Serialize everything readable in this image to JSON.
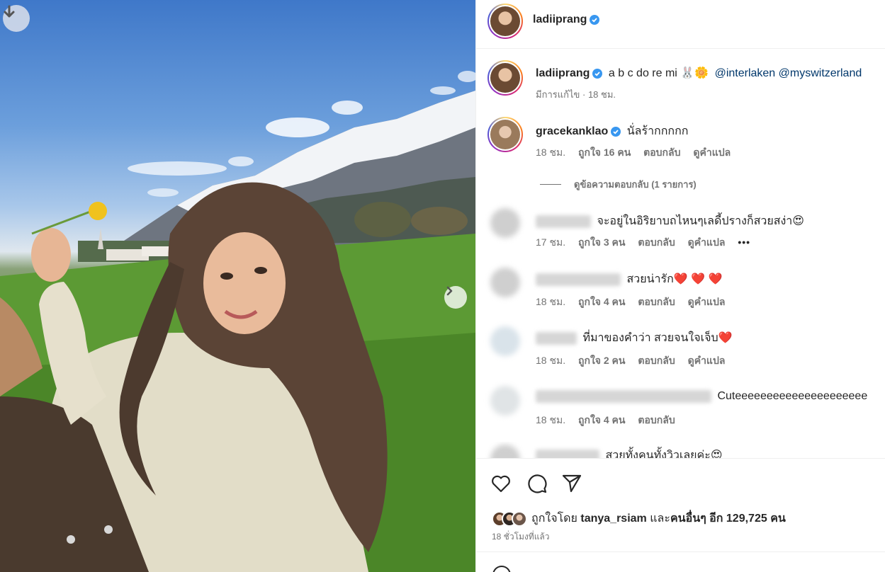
{
  "post": {
    "username": "ladiiprang",
    "caption_text": "a b c do re mi 🐰🌼",
    "caption_mentions": "@interlaken @myswitzerland",
    "caption_meta": "มีการแก้ไข · 18 ชม."
  },
  "comments": [
    {
      "user": "gracekanklao",
      "verified": true,
      "text": "นั่ลร้ากกกกก",
      "time": "18 ชม.",
      "likes": "ถูกใจ 16 คน",
      "reply": "ตอบกลับ",
      "translate": "ดูคำแปล"
    },
    {
      "user": "",
      "blurred": true,
      "text": "จะอยู่ในอิริยาบถไหนๆเลดี้ปรางก็สวยสง่า😍",
      "time": "17 ชม.",
      "likes": "ถูกใจ 3 คน",
      "reply": "ตอบกลับ",
      "translate": "ดูคำแปล",
      "more": "•••"
    },
    {
      "user": "",
      "blurred": true,
      "text": "สวยน่ารัก❤️ ❤️ ❤️",
      "time": "18 ชม.",
      "likes": "ถูกใจ 4 คน",
      "reply": "ตอบกลับ",
      "translate": "ดูคำแปล"
    },
    {
      "user": "",
      "blurred": true,
      "text": "ที่มาของคำว่า สวยจนใจเจ็บ❤️",
      "time": "18 ชม.",
      "likes": "ถูกใจ 2 คน",
      "reply": "ตอบกลับ",
      "translate": "ดูคำแปล"
    },
    {
      "user": "",
      "blurred": true,
      "text": "Cuteeeeeeeeeeeeeeeeeeeee",
      "time": "18 ชม.",
      "likes": "ถูกใจ 4 คน",
      "reply": "ตอบกลับ"
    },
    {
      "user": "",
      "blurred": true,
      "text": "สวยทั้งคนทั้งวิวเลยค่ะ😍"
    }
  ],
  "view_replies": "ดูข้อความตอบกลับ (1 รายการ)",
  "liked_by": {
    "prefix": "ถูกใจโดย",
    "user": "tanya_rsiam",
    "and": "และ",
    "others": "คนอื่นๆ อีก 129,725 คน"
  },
  "posted_time": "18 ชั่วโมงที่แล้ว",
  "icons": {
    "download": "arrow-down-icon",
    "next": "chevron-right-icon",
    "like": "heart-icon",
    "comment": "comment-icon",
    "share": "send-icon",
    "verified": "verified-badge-icon"
  },
  "colors": {
    "verified": "#3897f0",
    "mention": "#00376b",
    "meta": "#737373"
  }
}
